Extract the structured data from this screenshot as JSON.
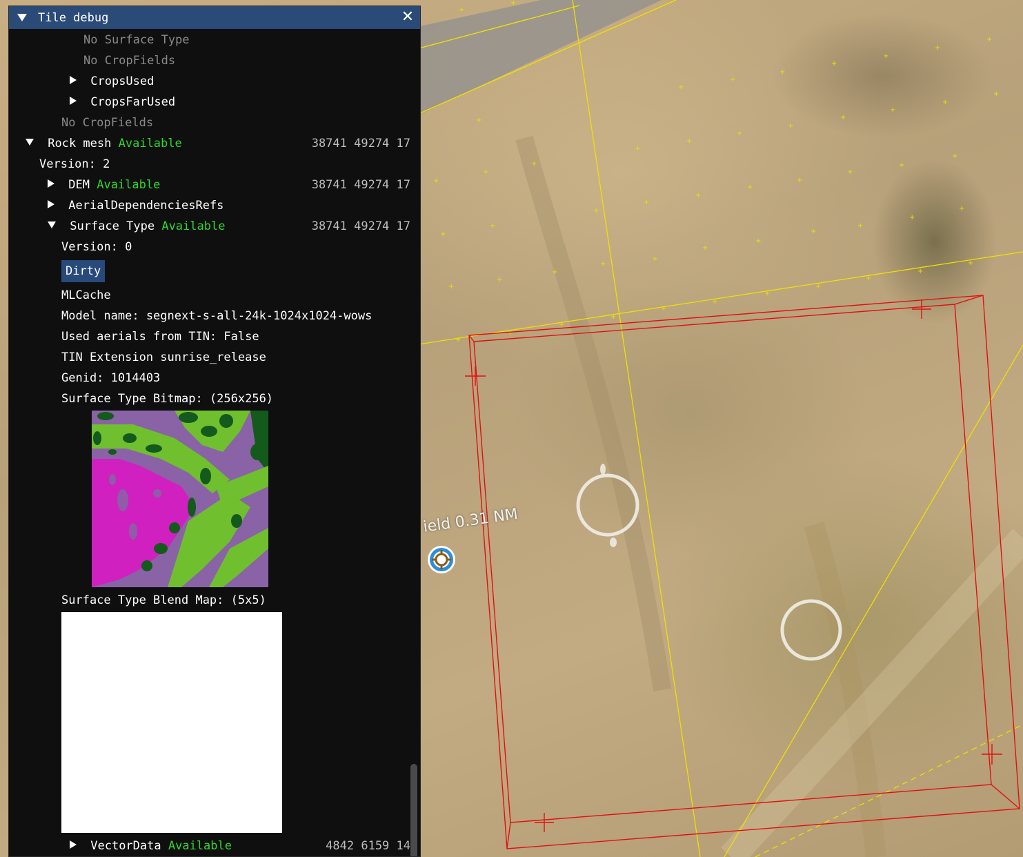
{
  "window": {
    "title": "Tile debug",
    "close_glyph": "✕"
  },
  "rows": {
    "no_surface_type": "No Surface Type",
    "no_cropfields_1": "No CropFields",
    "crops_used": "CropsUsed",
    "crops_far_used": "CropsFarUsed",
    "no_cropfields_2": "No CropFields",
    "rock_mesh": "Rock mesh",
    "rock_mesh_status": "Available",
    "rock_mesh_coords": "38741 49274 17",
    "version_2": "Version: 2",
    "dem": "DEM",
    "dem_status": "Available",
    "dem_coords": "38741 49274 17",
    "aerial_refs": "AerialDependenciesRefs",
    "surface_type": "Surface Type",
    "surface_type_status": "Available",
    "surface_type_coords": "38741 49274 17",
    "version_0": "Version: 0",
    "dirty": "Dirty",
    "mlcache": "MLCache",
    "model_name": "Model name: segnext-s-all-24k-1024x1024-wows",
    "used_aerials": "Used aerials from TIN: False",
    "tin_extension": "TIN Extension sunrise_release",
    "genid": "Genid: 1014403",
    "bitmap_label": "Surface Type Bitmap: (256x256)",
    "blend_label": "Surface Type Blend Map: (5x5)",
    "vector_data": "VectorData",
    "vector_data_status": "Available",
    "vector_data_coords": "4842 6159 14"
  },
  "map": {
    "field_label": "ield  0.31 NM",
    "location_icon": "target-icon"
  },
  "colors": {
    "titlebar": "#2a4a78",
    "available": "#2bd92b",
    "bounds": "#e01010",
    "grid": "#f0e000",
    "bitmap_purple": "#8a62a6",
    "bitmap_magenta": "#d020c0",
    "bitmap_green": "#6fbf2f",
    "bitmap_dark_green": "#135a1c"
  }
}
